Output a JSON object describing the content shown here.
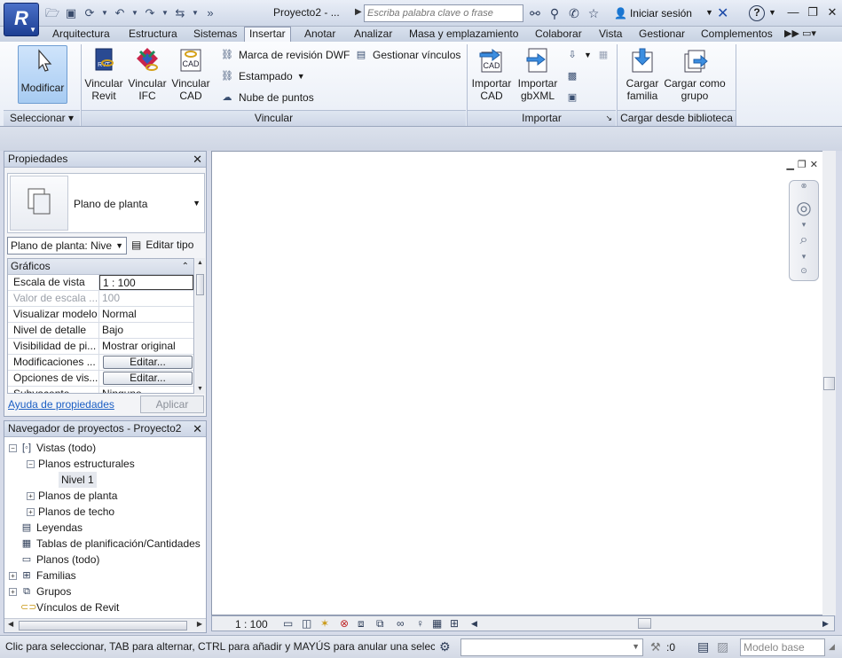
{
  "app": {
    "logo": "R",
    "window_title": "Proyecto2 - ...",
    "search_placeholder": "Escriba palabra clave o frase",
    "sign_in": "Iniciar sesión"
  },
  "tabs": [
    "Arquitectura",
    "Estructura",
    "Sistemas",
    "Insertar",
    "Anotar",
    "Analizar",
    "Masa y emplazamiento",
    "Colaborar",
    "Vista",
    "Gestionar",
    "Complementos"
  ],
  "active_tab": "Insertar",
  "ribbon": {
    "modificar": "Modificar",
    "vincular_revit": [
      "Vincular",
      "Revit"
    ],
    "vincular_ifc": [
      "Vincular",
      "IFC"
    ],
    "vincular_cad": [
      "Vincular",
      "CAD"
    ],
    "marca_dwf": "Marca de revisión DWF",
    "estampado": "Estampado",
    "nube_puntos": "Nube de puntos",
    "gestionar_vinculos": "Gestionar vínculos",
    "importar_cad": [
      "Importar",
      "CAD"
    ],
    "importar_gbxml": [
      "Importar",
      "gbXML"
    ],
    "cargar_familia": [
      "Cargar",
      "familia"
    ],
    "cargar_grupo": [
      "Cargar como",
      "grupo"
    ],
    "panels": {
      "seleccionar": "Seleccionar",
      "vincular": "Vincular",
      "importar": "Importar",
      "biblioteca": "Cargar desde biblioteca"
    }
  },
  "properties": {
    "title": "Propiedades",
    "type_name": "Plano de planta",
    "instance_select": "Plano de planta: Nive",
    "edit_type": "Editar tipo",
    "group": "Gráficos",
    "rows": [
      {
        "key": "Escala de vista",
        "value": "1 : 100"
      },
      {
        "key": "Valor de escala ...",
        "value": "100"
      },
      {
        "key": "Visualizar modelo",
        "value": "Normal"
      },
      {
        "key": "Nivel de detalle",
        "value": "Bajo"
      },
      {
        "key": "Visibilidad de pi...",
        "value": "Mostrar original"
      },
      {
        "key": "Modificaciones ...",
        "value": "Editar..."
      },
      {
        "key": "Opciones de vis...",
        "value": "Editar..."
      },
      {
        "key": "Subyacente",
        "value": "Ninguno"
      }
    ],
    "help_link": "Ayuda de propiedades",
    "apply": "Aplicar"
  },
  "browser": {
    "title": "Navegador de proyectos - Proyecto2",
    "nodes": [
      "Vistas (todo)",
      "Planos estructurales",
      "Nivel 1",
      "Planos de planta",
      "Planos de techo",
      "Leyendas",
      "Tablas de planificación/Cantidades",
      "Planos (todo)",
      "Familias",
      "Grupos",
      "Vínculos de Revit"
    ]
  },
  "viewbar": {
    "scale": "1 : 100"
  },
  "status": {
    "text": "Clic para seleccionar, TAB para alternar, CTRL para añadir y MAYÚS para anular una selecció",
    "count": ":0",
    "model": "Modelo base"
  }
}
